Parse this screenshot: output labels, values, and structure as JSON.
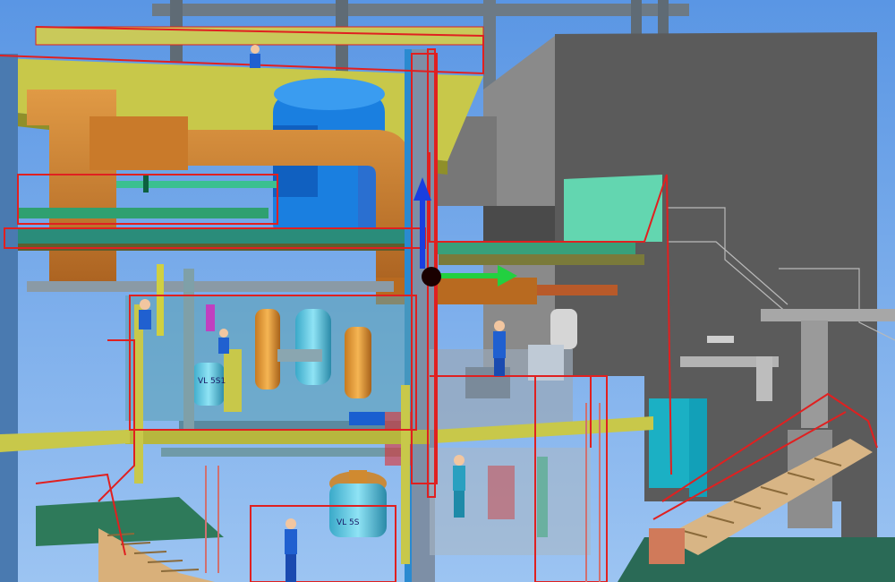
{
  "scene": {
    "type": "3d-plant-model-view",
    "background_color": "#6fa3e6",
    "selection_color": "#e02020",
    "vessel_tags": [
      "VL 5S1",
      "VL 5S"
    ],
    "gizmo": {
      "axes": [
        "y-axis",
        "x-axis"
      ],
      "y_color": "#1a3fe0",
      "x_color": "#22d040",
      "origin_color": "#1a0000"
    },
    "figures": 6
  }
}
